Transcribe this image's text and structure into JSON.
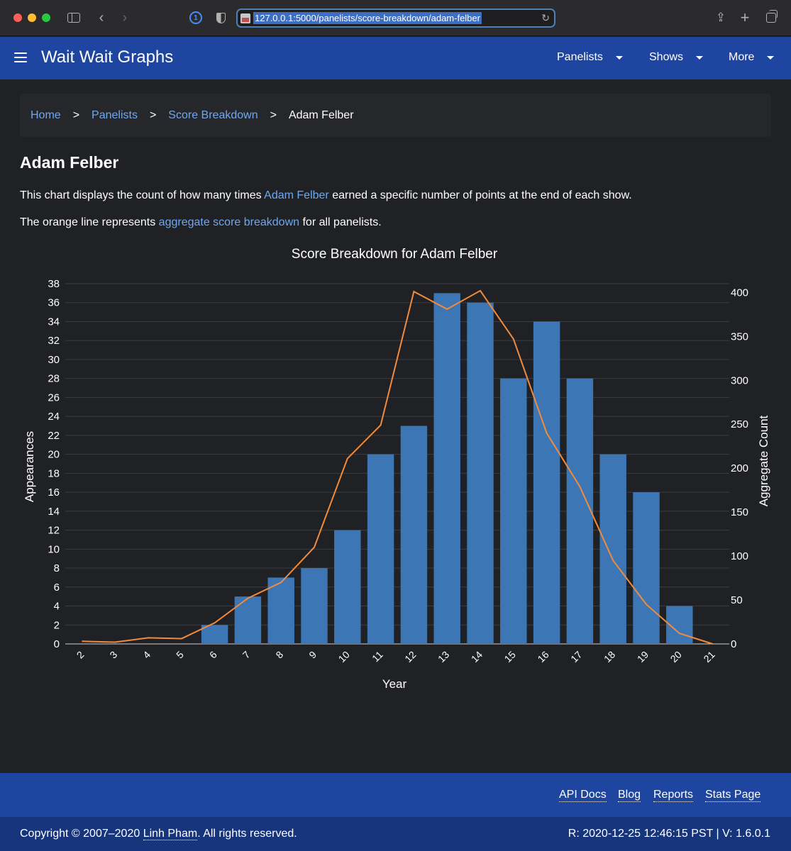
{
  "browser": {
    "url": "127.0.0.1:5000/panelists/score-breakdown/adam-felber"
  },
  "nav": {
    "brand": "Wait Wait Graphs",
    "menus": [
      "Panelists",
      "Shows",
      "More"
    ]
  },
  "breadcrumb": {
    "home": "Home",
    "panelists": "Panelists",
    "score_breakdown": "Score Breakdown",
    "current": "Adam Felber",
    "separator": ">"
  },
  "page": {
    "title": "Adam Felber",
    "desc1_pre": "This chart displays the count of how many times ",
    "desc1_link": "Adam Felber",
    "desc1_post": " earned a specific number of points at the end of each show.",
    "desc2_pre": "The orange line represents ",
    "desc2_link": "aggregate score breakdown",
    "desc2_post": " for all panelists."
  },
  "chart_data": {
    "type": "bar",
    "title": "Score Breakdown for Adam Felber",
    "xlabel": "Year",
    "ylabel": "Appearances",
    "y2label": "Aggregate Count",
    "categories": [
      "2",
      "3",
      "4",
      "5",
      "6",
      "7",
      "8",
      "9",
      "10",
      "11",
      "12",
      "13",
      "14",
      "15",
      "16",
      "17",
      "18",
      "19",
      "20",
      "21"
    ],
    "ylim": [
      0,
      38
    ],
    "y2lim": [
      0,
      410
    ],
    "yticks": [
      0,
      2,
      4,
      6,
      8,
      10,
      12,
      14,
      16,
      18,
      20,
      22,
      24,
      26,
      28,
      30,
      32,
      34,
      36,
      38
    ],
    "y2ticks": [
      0,
      50,
      100,
      150,
      200,
      250,
      300,
      350,
      400
    ],
    "series": [
      {
        "type": "bar",
        "values": [
          0,
          0,
          0,
          0,
          2,
          5,
          7,
          8,
          12,
          20,
          23,
          37,
          36,
          28,
          34,
          28,
          20,
          16,
          4,
          0
        ],
        "color": "#3c76b5",
        "axis": "left"
      },
      {
        "type": "line",
        "values": [
          3,
          2,
          7,
          6,
          24,
          52,
          70,
          110,
          211,
          249,
          401,
          381,
          402,
          347,
          240,
          179,
          95,
          45,
          12,
          0
        ],
        "color": "#f28b3c",
        "axis": "right"
      }
    ],
    "grid": true,
    "legend": "none"
  },
  "footer": {
    "links": [
      "API Docs",
      "Blog",
      "Reports",
      "Stats Page"
    ],
    "copyright_pre": "Copyright © 2007–2020 ",
    "copyright_link": "Linh Pham",
    "copyright_post": ". All rights reserved.",
    "version": "R: 2020-12-25 12:46:15 PST | V: 1.6.0.1"
  }
}
